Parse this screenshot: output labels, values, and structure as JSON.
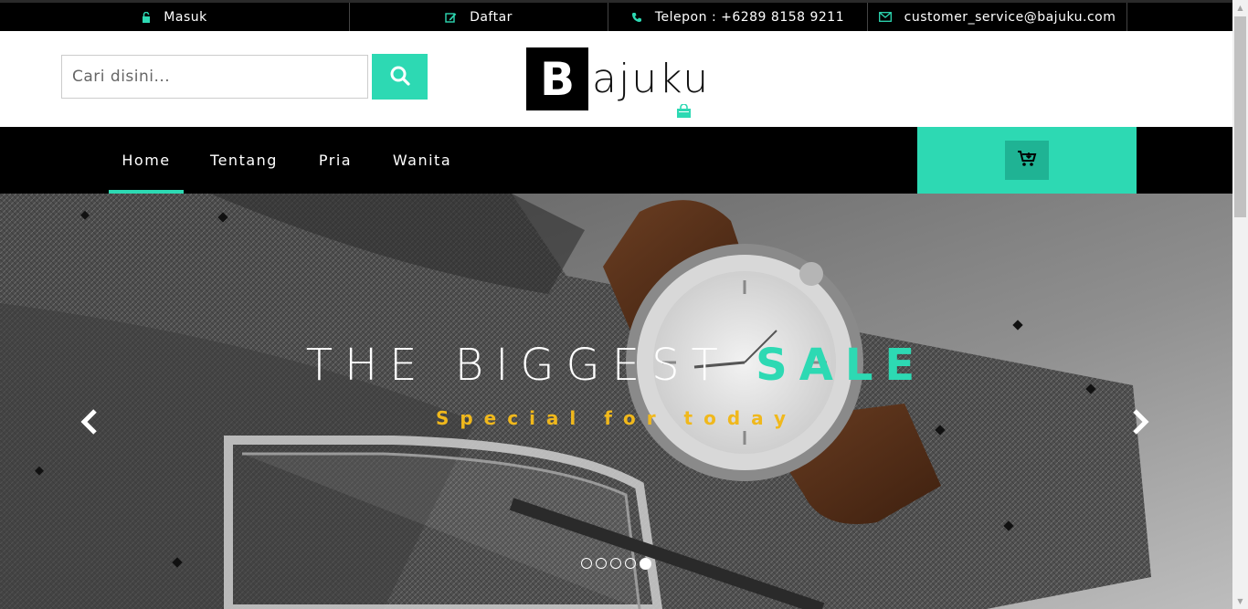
{
  "topbar": {
    "items": [
      {
        "label": "Masuk",
        "icon": "lock-icon"
      },
      {
        "label": "Daftar",
        "icon": "edit-icon"
      },
      {
        "label": "Telepon : +6289 8158 9211",
        "icon": "phone-icon"
      },
      {
        "label": "customer_service@bajuku.com",
        "icon": "envelope-icon"
      }
    ]
  },
  "header": {
    "search_placeholder": "Cari disini...",
    "logo_letter": "B",
    "logo_rest": "ajuku"
  },
  "nav": {
    "items": [
      {
        "label": "Home",
        "active": true
      },
      {
        "label": "Tentang",
        "active": false
      },
      {
        "label": "Pria",
        "active": false
      },
      {
        "label": "Wanita",
        "active": false
      }
    ]
  },
  "hero": {
    "title_plain": "THE BIGGEST ",
    "title_accent": "SALE",
    "subtitle": "Special for today",
    "slides": 5,
    "active_slide": 5
  },
  "colors": {
    "accent": "#2dd9b3",
    "accent_dark": "#1fb394",
    "subtitle": "#f0b81c",
    "bar": "#000000"
  }
}
